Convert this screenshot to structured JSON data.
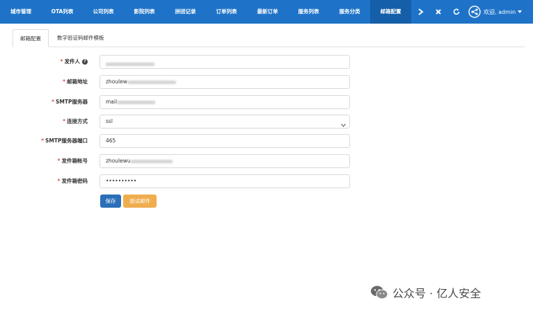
{
  "nav": {
    "items": [
      "城市管理",
      "OTA列表",
      "公司列表",
      "影院列表",
      "拼团记录",
      "订单列表",
      "最新订单",
      "服务列表",
      "服务分类",
      "邮箱配置"
    ],
    "active_index": 9,
    "user_greeting": "欢迎, admin"
  },
  "tabs": [
    "邮箱配置",
    "数字验证码邮件模板"
  ],
  "form": {
    "sender_label": "发件人",
    "email_address_label": "邮箱地址",
    "email_address_value": "zhoulew",
    "smtp_server_label": "SMTP服务器",
    "smtp_server_value": "mail",
    "connection_label": "连接方式",
    "connection_value": "ssl",
    "smtp_port_label": "SMTP服务器端口",
    "smtp_port_value": "465",
    "account_label": "发件箱帐号",
    "account_value": "zhoulewu",
    "password_label": "发件箱密码",
    "password_value": "••••••••••",
    "save_label": "保存",
    "test_label": "测试邮件"
  },
  "watermark": "公众号 · 亿人安全",
  "colors": {
    "nav_bg": "#1e73c8",
    "primary": "#2a6fb8",
    "warning": "#f0ad4e",
    "required": "#d9534f"
  }
}
